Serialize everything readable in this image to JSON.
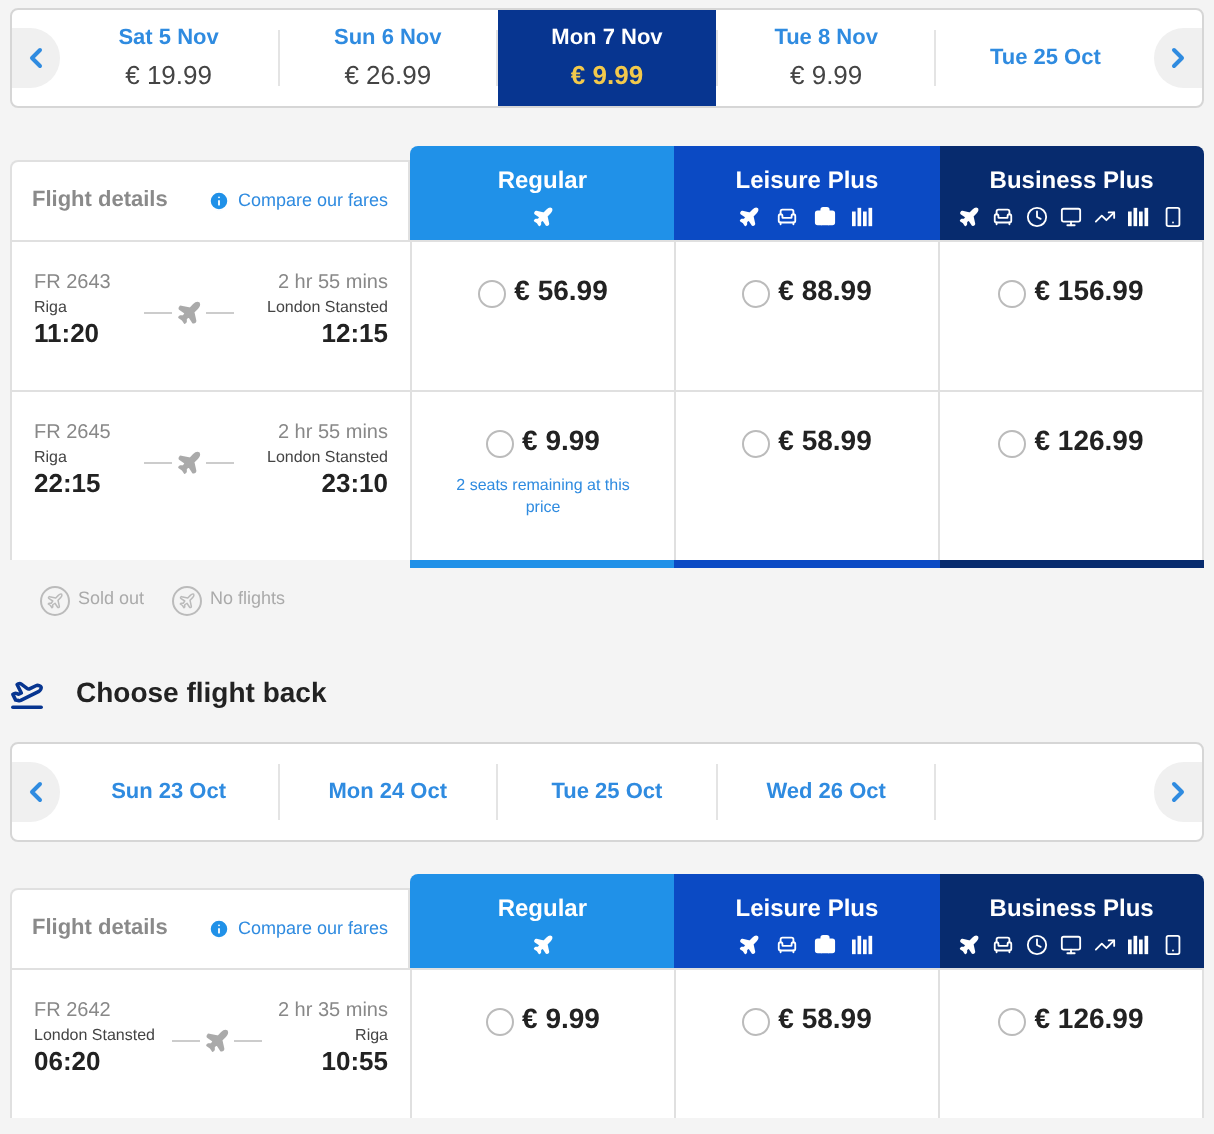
{
  "outbound": {
    "dates": [
      {
        "day": "Sat 5 Nov",
        "price": "€ 19.99",
        "selected": false
      },
      {
        "day": "Sun 6 Nov",
        "price": "€ 26.99",
        "selected": false
      },
      {
        "day": "Mon 7 Nov",
        "price": "€ 9.99",
        "selected": true
      },
      {
        "day": "Tue 8 Nov",
        "price": "€ 9.99",
        "selected": false
      },
      {
        "day": "Tue 25 Oct",
        "selected": false
      }
    ],
    "table": {
      "details_label": "Flight details",
      "compare_link": "Compare our fares",
      "fares": [
        {
          "name": "Regular",
          "kind": "regular",
          "color": "#2091e8"
        },
        {
          "name": "Leisure Plus",
          "kind": "leisure",
          "color": "#0b4ac4"
        },
        {
          "name": "Business Plus",
          "kind": "business",
          "color": "#072b6e"
        }
      ],
      "flights": [
        {
          "number": "FR 2643",
          "from": "Riga",
          "depart": "11:20",
          "duration": "2 hr 55 mins",
          "to": "London Stansted",
          "arrive": "12:15",
          "prices": [
            {
              "price": "€ 56.99",
              "selected": false
            },
            {
              "price": "€ 88.99",
              "selected": false
            },
            {
              "price": "€ 156.99",
              "selected": false
            }
          ]
        },
        {
          "number": "FR 2645",
          "from": "Riga",
          "depart": "22:15",
          "duration": "2 hr 55 mins",
          "to": "London Stansted",
          "arrive": "23:10",
          "prices": [
            {
              "price": "€ 9.99",
              "selected": false,
              "note": "2 seats remaining at this price"
            },
            {
              "price": "€ 58.99",
              "selected": false
            },
            {
              "price": "€ 126.99",
              "selected": false
            }
          ]
        }
      ]
    },
    "legend": [
      "Sold out",
      "No flights"
    ]
  },
  "return_heading": "Choose flight back",
  "return": {
    "dates": [
      {
        "day": "Sun 23 Oct",
        "selected": false
      },
      {
        "day": "Mon 24 Oct",
        "selected": false
      },
      {
        "day": "Tue 25 Oct",
        "selected": false
      },
      {
        "day": "Wed 26 Oct",
        "selected": false
      }
    ],
    "table": {
      "details_label": "Flight details",
      "compare_link": "Compare our fares",
      "fares": [
        {
          "name": "Regular",
          "kind": "regular",
          "color": "#2091e8"
        },
        {
          "name": "Leisure Plus",
          "kind": "leisure",
          "color": "#0b4ac4"
        },
        {
          "name": "Business Plus",
          "kind": "business",
          "color": "#072b6e"
        }
      ],
      "flights": [
        {
          "number": "FR 2642",
          "from": "London Stansted",
          "depart": "06:20",
          "duration": "2 hr 35 mins",
          "to": "Riga",
          "arrive": "10:55",
          "prices": [
            {
              "price": "€ 9.99",
              "selected": false
            },
            {
              "price": "€ 58.99",
              "selected": false
            },
            {
              "price": "€ 126.99",
              "selected": false
            }
          ]
        }
      ]
    }
  }
}
